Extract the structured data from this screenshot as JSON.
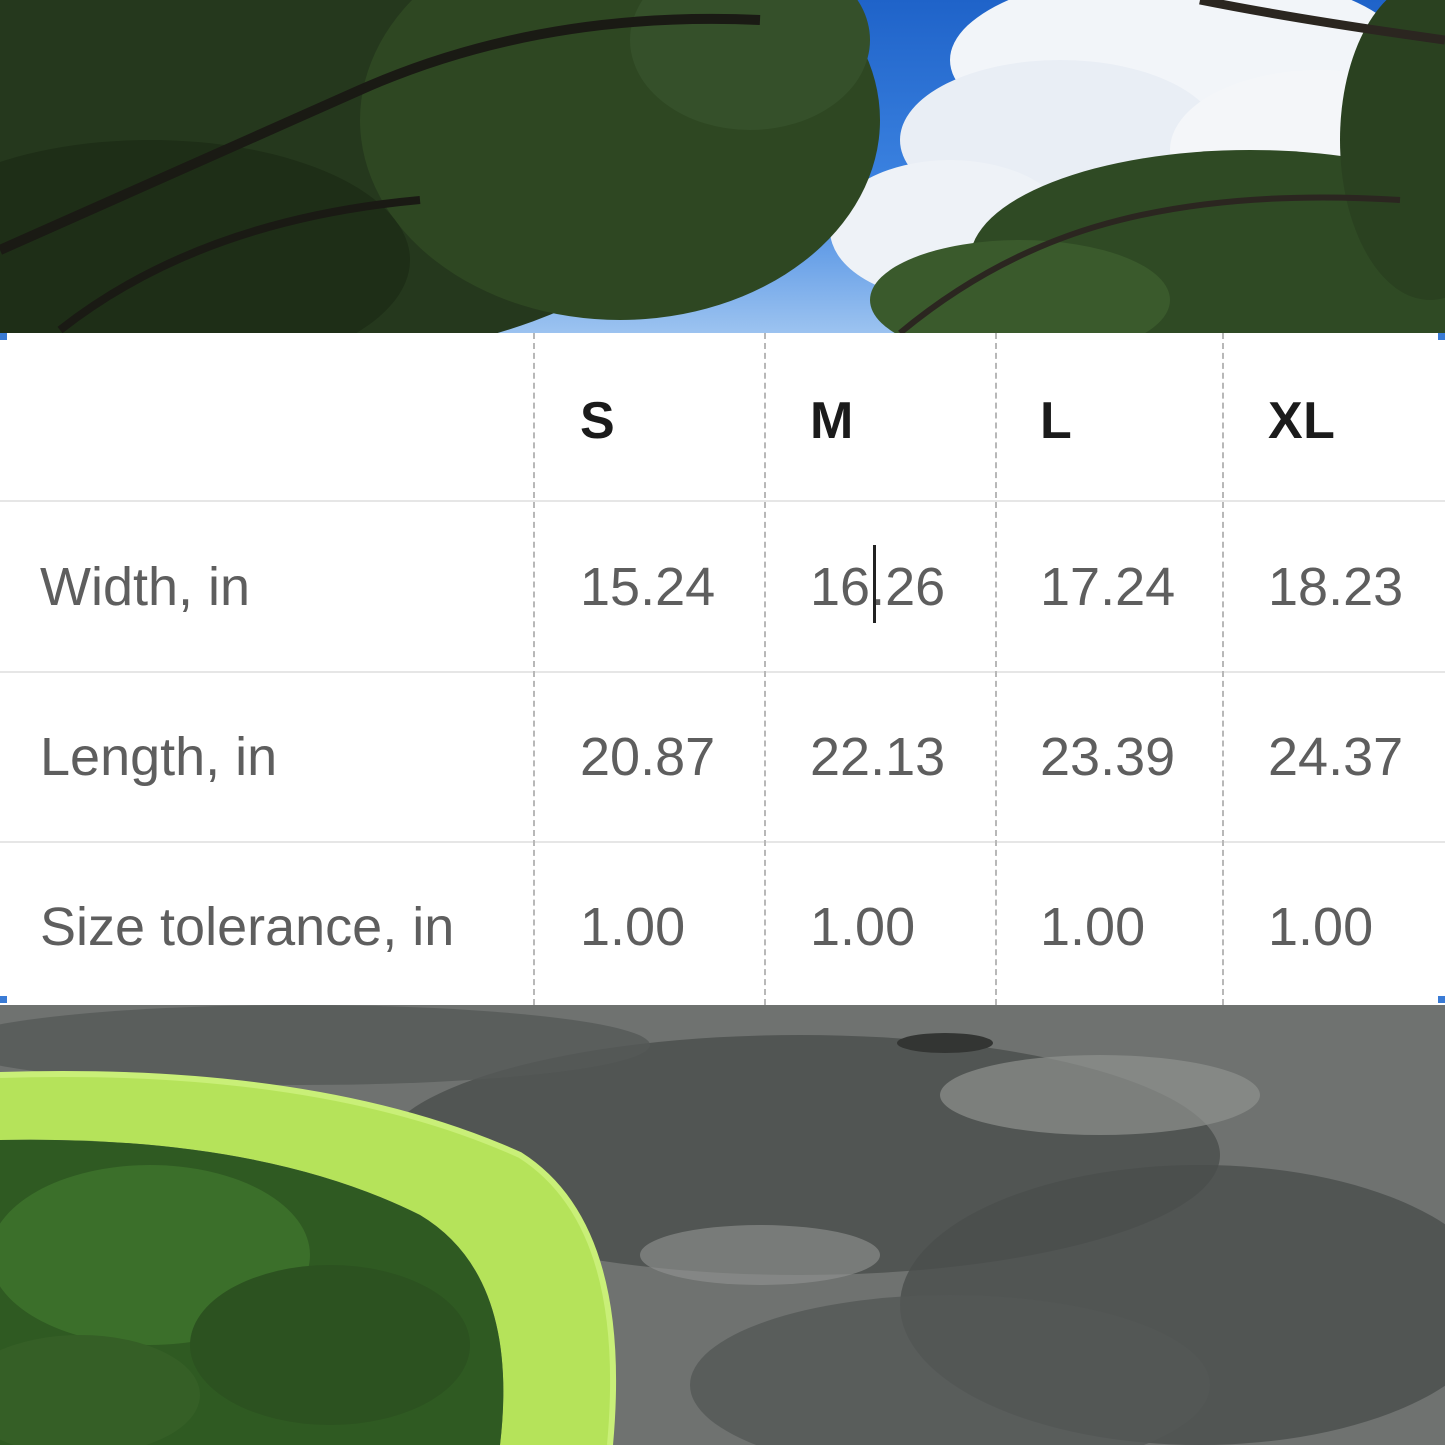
{
  "table": {
    "columns": [
      "S",
      "M",
      "L",
      "XL"
    ],
    "rows": [
      {
        "label": "Width, in",
        "values": [
          "15.24",
          "16.26",
          "17.24",
          "18.23"
        ]
      },
      {
        "label": "Length, in",
        "values": [
          "20.87",
          "22.13",
          "23.39",
          "24.37"
        ]
      },
      {
        "label": "Size tolerance, in",
        "values": [
          "1.00",
          "1.00",
          "1.00",
          "1.00"
        ]
      }
    ]
  },
  "colors": {
    "selection_handle": "#3a7bd5",
    "header_text": "#1b1b1b",
    "body_text": "#5e5e5e"
  }
}
